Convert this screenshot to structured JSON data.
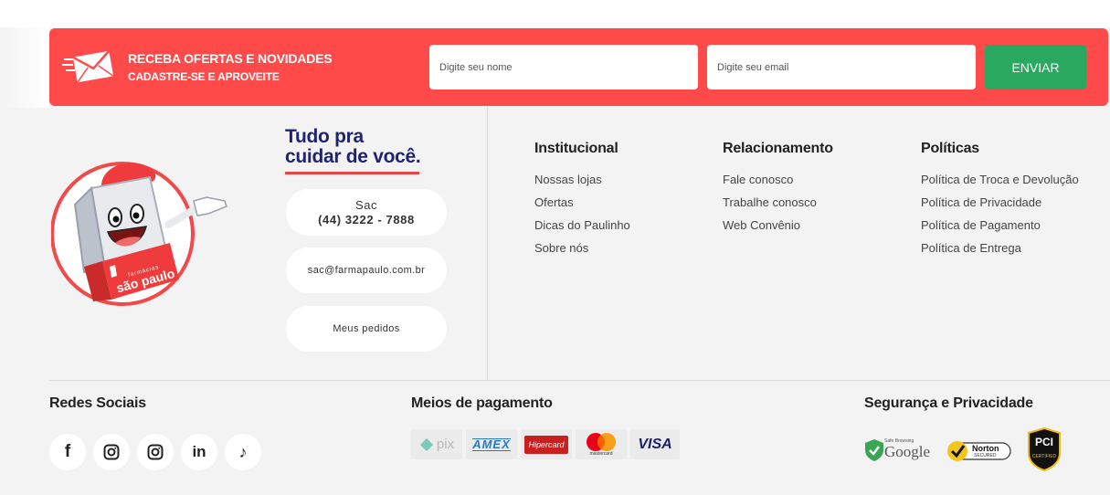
{
  "newsletter": {
    "title": "RECEBA OFERTAS E NOVIDADES",
    "subtitle": "CADASTRE-SE E APROVEITE",
    "name_placeholder": "Digite seu nome",
    "email_placeholder": "Digite seu email",
    "send_label": "ENVIAR",
    "icon": "envelope-icon",
    "accent_color": "#ff4a4a",
    "button_color": "#2aa860"
  },
  "brand": {
    "logo_text": "farmácias",
    "logo_name": "são paulo",
    "slogan_line1": "Tudo pra",
    "slogan_line2": "cuidar de você."
  },
  "contact": {
    "sac_label": "Sac",
    "sac_phone": "(44) 3222 - 7888",
    "email": "sac@farmapaulo.com.br",
    "orders_label": "Meus pedidos"
  },
  "columns": [
    {
      "title": "Institucional",
      "links": [
        "Nossas lojas",
        "Ofertas",
        "Dicas do Paulinho",
        "Sobre nós"
      ]
    },
    {
      "title": "Relacionamento",
      "links": [
        "Fale conosco",
        "Trabalhe conosco",
        "Web Convênio"
      ]
    },
    {
      "title": "Políticas",
      "links": [
        "Política de Troca e Devolução",
        "Política de Privacidade",
        "Política de Pagamento",
        "Política de Entrega"
      ]
    }
  ],
  "bottom": {
    "social_title": "Redes Sociais",
    "payment_title": "Meios de pagamento",
    "security_title": "Segurança e Privacidade",
    "social_icons": [
      "facebook-icon",
      "instagram-icon",
      "instagram-icon",
      "linkedin-icon",
      "tiktok-icon"
    ],
    "social_glyphs": [
      "f",
      "in",
      "♪"
    ],
    "payments": {
      "pix": "pix",
      "amex": "AMEX",
      "hipercard": "Hipercard",
      "mastercard": "mastercard",
      "visa": "VISA"
    },
    "seals": {
      "google_small": "Safe Browsing",
      "google": "Google",
      "norton": "Norton",
      "norton_sub": "SECURED",
      "pci": "PCI",
      "pci_sub": "CERTIFIED"
    }
  }
}
